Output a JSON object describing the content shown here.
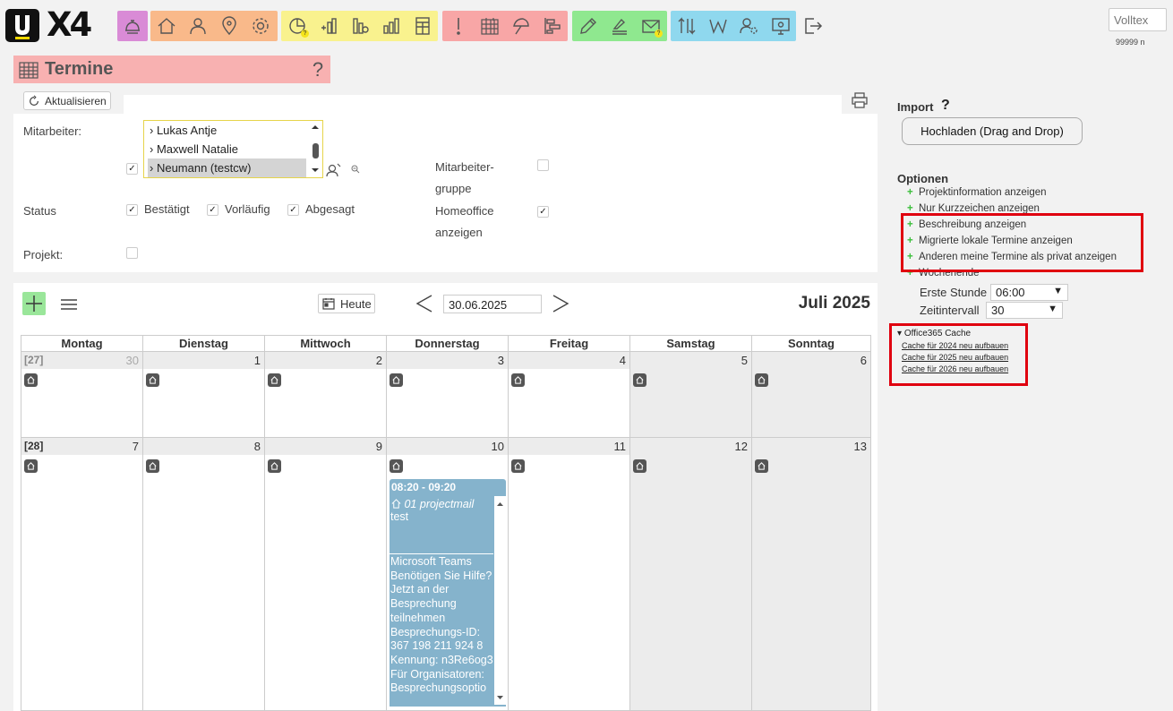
{
  "app": {
    "logo_u": "U",
    "logo_x4": "X4",
    "search_placeholder": "Volltex",
    "version": "99999 n"
  },
  "toolbar": {
    "groups": [
      {
        "color": "#d98bd6",
        "icons": [
          "bell-icon"
        ]
      },
      {
        "color": "#f9b98a",
        "icons": [
          "home-icon",
          "person-icon",
          "location-pin-icon",
          "settings-gear-icon"
        ]
      },
      {
        "color": "#f9f28e",
        "icons": [
          "pie-chart-icon",
          "coin-stack-icon",
          "coin-minus-icon",
          "bar-chart-icon",
          "spreadsheet-icon"
        ]
      },
      {
        "color": "#f8a6a6",
        "icons": [
          "exclamation-icon",
          "calendar-grid-icon",
          "umbrella-icon",
          "gantt-icon"
        ]
      },
      {
        "color": "#8fe88f",
        "icons": [
          "pencil-icon",
          "signature-icon",
          "mail-icon"
        ]
      },
      {
        "color": "#8fd8ee",
        "icons": [
          "sort-arrows-icon",
          "word-w-icon",
          "user-settings-icon",
          "monitor-icon"
        ]
      }
    ],
    "badge_text": "?"
  },
  "page": {
    "title": "Termine",
    "help": "?"
  },
  "filters": {
    "refresh_label": "Aktualisieren",
    "employee_label": "Mitarbeiter:",
    "employees": [
      "Lukas Antje",
      "Maxwell Natalie",
      "Neumann (testcw)"
    ],
    "selected_employee": "Neumann (testcw)",
    "group_label_1": "Mitarbeiter-",
    "group_label_2": "gruppe",
    "status_label": "Status",
    "status_confirmed": "Bestätigt",
    "status_preliminary": "Vorläufig",
    "status_cancelled": "Abgesagt",
    "homeoffice_label_1": "Homeoffice",
    "homeoffice_label_2": "anzeigen",
    "project_label": "Projekt:"
  },
  "calendar": {
    "today_label": "Heute",
    "date_value": "30.06.2025",
    "month_title": "Juli 2025",
    "weekdays": [
      "Montag",
      "Dienstag",
      "Mittwoch",
      "Donnerstag",
      "Freitag",
      "Samstag",
      "Sonntag"
    ],
    "weeks": [
      {
        "label": "[27]",
        "days": [
          "30",
          "1",
          "2",
          "3",
          "4",
          "5",
          "6"
        ]
      },
      {
        "label": "[28]",
        "days": [
          "7",
          "8",
          "9",
          "10",
          "11",
          "12",
          "13"
        ]
      }
    ],
    "event": {
      "time": "08:20 - 09:20",
      "title": "01 projectmail",
      "subtitle": "test",
      "description": "Microsoft Teams Benötigen Sie Hilfe? Jetzt an der Besprechung teilnehmen Besprechungs-ID: 367 198 211 924 8 Kennung: n3Re6og3 Für Organisatoren: Besprechungsoptio",
      "color": "#85b3cc"
    }
  },
  "right_panel": {
    "import_label": "Import",
    "import_help": "?",
    "upload_label": "Hochladen (Drag and Drop)",
    "options_title": "Optionen",
    "options": [
      "Projektinformation anzeigen",
      "Nur Kurzzeichen anzeigen",
      "Beschreibung anzeigen",
      "Migrierte lokale Termine anzeigen",
      "Anderen meine Termine als privat anzeigen",
      "Wochenende"
    ],
    "first_hour_label": "Erste Stunde",
    "first_hour_value": "06:00",
    "interval_label": "Zeitintervall",
    "interval_value": "30",
    "o365_title": "Office365 Cache",
    "o365_links": [
      "Cache für 2024 neu aufbauen",
      "Cache für 2025 neu aufbauen",
      "Cache für 2026 neu aufbauen"
    ],
    "highlight_color": "#e0000f"
  }
}
